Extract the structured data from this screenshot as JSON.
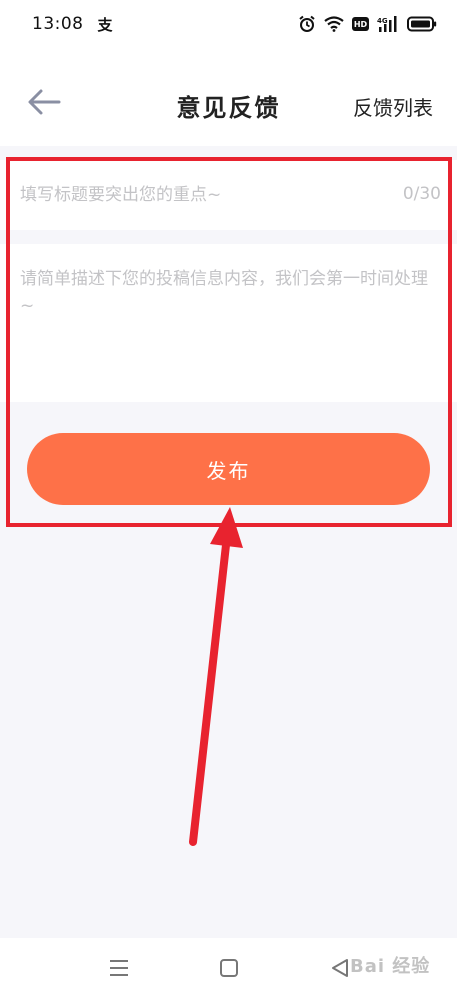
{
  "status_bar": {
    "time": "13:08",
    "app_icon_glyph": "支",
    "icons": [
      "alarm-icon",
      "wifi-icon",
      "hd-icon",
      "signal-4g-icon",
      "battery-icon"
    ],
    "hd_label": "HD",
    "network_label": "4G"
  },
  "header": {
    "back_icon": "arrow-left-icon",
    "title": "意见反馈",
    "feedback_list_label": "反馈列表"
  },
  "form": {
    "title_placeholder": "填写标题要突出您的重点~",
    "title_counter": "0/30",
    "content_placeholder": "请简单描述下您的投稿信息内容，我们会第一时间处理~",
    "publish_label": "发布"
  },
  "nav_bar": {
    "icons": [
      "menu-icon",
      "home-square-icon",
      "back-triangle-icon"
    ],
    "watermark": "Bai 经验"
  },
  "colors": {
    "accent": "#fe7148",
    "annotation": "#e8232f",
    "page_background": "#f6f6fa",
    "placeholder": "#c3c3c6"
  }
}
